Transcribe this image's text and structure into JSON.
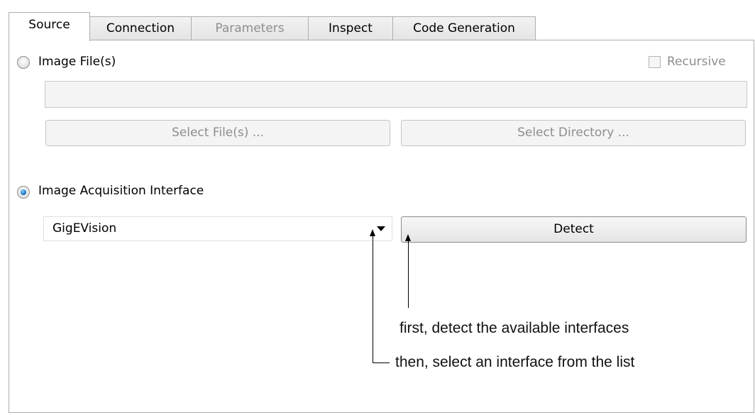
{
  "tabs": [
    {
      "label": "Source",
      "state": "active"
    },
    {
      "label": "Connection",
      "state": "normal"
    },
    {
      "label": "Parameters",
      "state": "disabled"
    },
    {
      "label": "Inspect",
      "state": "normal"
    },
    {
      "label": "Code Generation",
      "state": "normal"
    }
  ],
  "source": {
    "image_files_label": "Image File(s)",
    "recursive_label": "Recursive",
    "recursive_checked": false,
    "file_path_value": "",
    "select_files_label": "Select File(s) ...",
    "select_directory_label": "Select Directory ...",
    "acq_interface_label": "Image Acquisition Interface",
    "selected_mode": "Image Acquisition Interface",
    "interface_value": "GigEVision",
    "detect_label": "Detect"
  },
  "annotations": {
    "first": "first, detect the available interfaces",
    "then": "then, select an interface from the list"
  },
  "colors": {
    "radio_selected": "#1e78c8",
    "disabled_text": "#8e8e8e",
    "border": "#adadad"
  }
}
